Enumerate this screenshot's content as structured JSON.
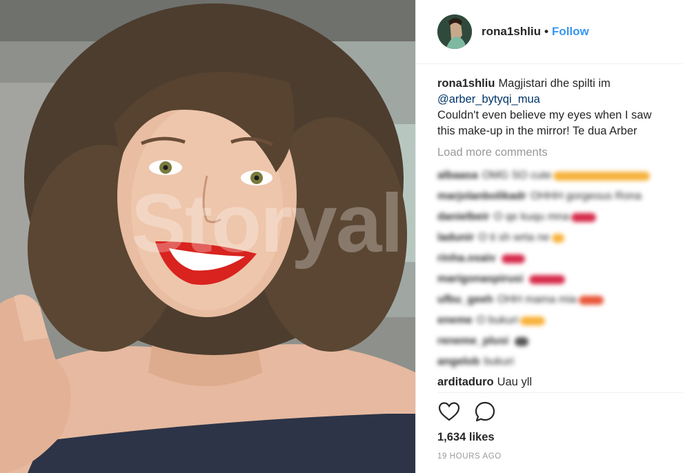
{
  "post": {
    "watermark": "Storyal"
  },
  "header": {
    "username": "rona1shliu",
    "separator": "•",
    "follow_label": "Follow"
  },
  "caption": {
    "username": "rona1shliu",
    "text_1": "Magjistari dhe spilti im",
    "mention": "@arber_bytyqi_mua",
    "text_2": "Couldn't even believe my eyes when I saw this make-up in the mirror! Te dua Arber"
  },
  "comments": {
    "load_more_label": "Load more comments",
    "blurred": [
      {
        "name": "albaasa",
        "text": "OMG SO cute",
        "emoji_color": "#f7b23b",
        "emoji_width": 140
      },
      {
        "name": "marjolanbolikadr",
        "text": "OHHH gorgeous Rona",
        "emoji_color": "",
        "emoji_width": 0
      },
      {
        "name": "danielbeir",
        "text": "O qe kuqu mna",
        "emoji_color": "#d62a4a",
        "emoji_width": 36
      },
      {
        "name": "ladunir",
        "text": "O ti sh wrta ne",
        "emoji_color": "#f7b23b",
        "emoji_width": 18
      },
      {
        "name": "rinha.osaiv",
        "text": "",
        "emoji_color": "#d62a4a",
        "emoji_width": 34
      },
      {
        "name": "marigonaspirusi",
        "text": "",
        "emoji_color": "#d62a4a",
        "emoji_width": 52
      },
      {
        "name": "ufbu_geeh",
        "text": "OHH mama mia",
        "emoji_color": "#e8563a",
        "emoji_width": 36
      },
      {
        "name": "eneme",
        "text": "O bukuri",
        "emoji_color": "#f7b23b",
        "emoji_width": 36
      },
      {
        "name": "reneme_plusi",
        "text": "",
        "emoji_color": "#555555",
        "emoji_width": 20
      },
      {
        "name": "angelob",
        "text": "bukuri",
        "emoji_color": "",
        "emoji_width": 0
      }
    ],
    "last": {
      "username": "arditaduro",
      "text": "Uau yll"
    }
  },
  "actions": {
    "like_icon": "heart-outline-icon",
    "comment_icon": "comment-bubble-icon"
  },
  "stats": {
    "likes": "1,634 likes",
    "time": "19 HOURS AGO"
  },
  "colors": {
    "link_blue": "#3897f0",
    "mention_navy": "#003569",
    "muted_gray": "#999999",
    "text_dark": "#262626",
    "lipstick_red": "#d8231f"
  }
}
